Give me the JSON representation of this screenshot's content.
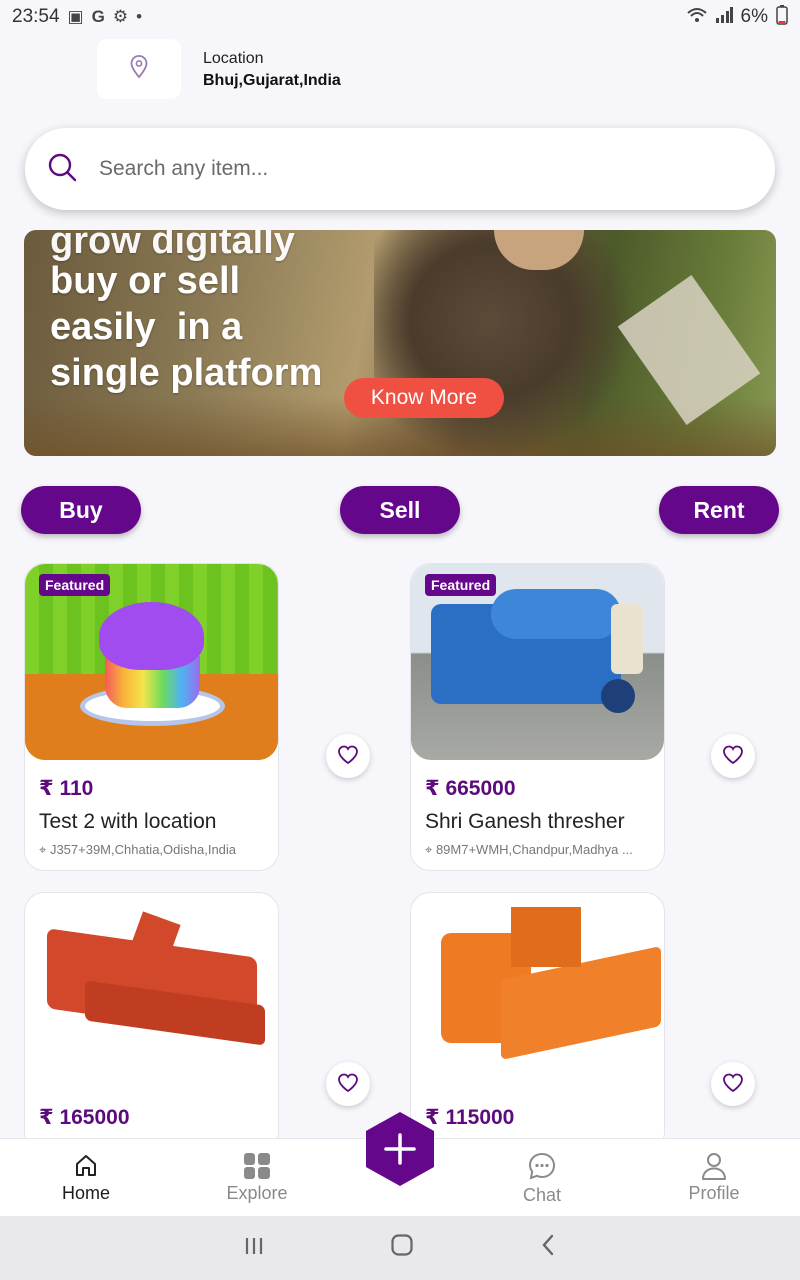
{
  "status_bar": {
    "time": "23:54",
    "battery": "6%"
  },
  "location": {
    "label": "Location",
    "value": "Bhuj,Gujarat,India"
  },
  "search": {
    "placeholder": "Search any item..."
  },
  "banner": {
    "line_cut": "grow digitally",
    "line1": "buy or sell",
    "line2": "easily  in a",
    "line3": "single platform",
    "cta": "Know More"
  },
  "actions": {
    "buy": "Buy",
    "sell": "Sell",
    "rent": "Rent"
  },
  "products": [
    {
      "badge": "Featured",
      "price": "₹ 110",
      "title": "Test 2 with location",
      "address": "J357+39M,Chhatia,Odisha,India"
    },
    {
      "badge": "Featured",
      "price": "₹ 665000",
      "title": "Shri Ganesh thresher",
      "address": "89M7+WMH,Chandpur,Madhya ..."
    },
    {
      "badge": "",
      "price": "₹ 165000",
      "title": "",
      "address": ""
    },
    {
      "badge": "",
      "price": "₹ 115000",
      "title": "",
      "address": ""
    }
  ],
  "bottom_nav": {
    "home": "Home",
    "explore": "Explore",
    "chat": "Chat",
    "profile": "Profile"
  },
  "colors": {
    "brand": "#65078b",
    "accent": "#ef5042"
  }
}
